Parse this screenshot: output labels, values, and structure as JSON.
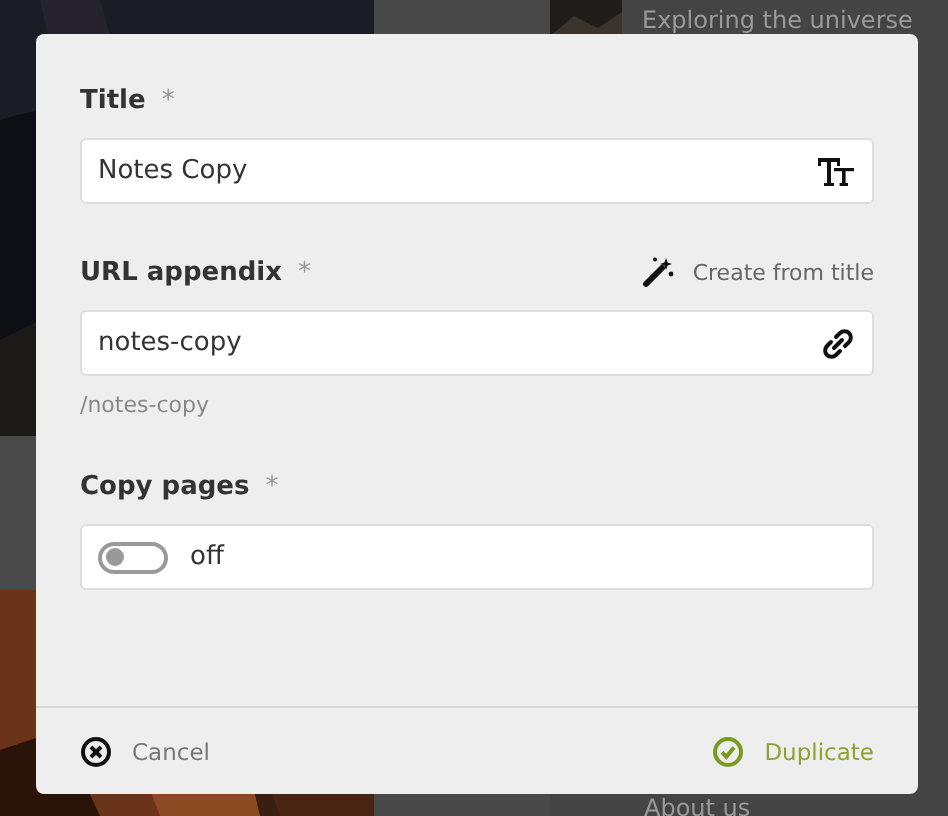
{
  "background": {
    "items": [
      {
        "title": "Exploring the universe"
      },
      {
        "title": "About us"
      }
    ]
  },
  "dialog": {
    "fields": [
      {
        "kind": "text",
        "label": "Title",
        "mark": "*",
        "value": "Notes Copy"
      },
      {
        "kind": "url",
        "label": "URL appendix",
        "mark": "*",
        "action": "Create from title",
        "value": "notes-copy",
        "hint": "/notes-copy"
      },
      {
        "kind": "toggle",
        "label": "Copy pages",
        "mark": "*",
        "on": false,
        "value": "off"
      }
    ],
    "cancel": "Cancel",
    "confirm": "Duplicate"
  }
}
